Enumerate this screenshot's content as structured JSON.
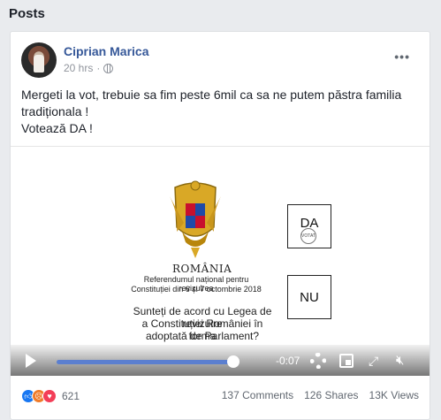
{
  "section": {
    "title": "Posts"
  },
  "post": {
    "author": "Ciprian Marica",
    "time": "20 hrs",
    "more": "•••",
    "text_lines": [
      "Mergeti la vot, trebuie sa fim peste 6mil ca sa ne putem păstra familia",
      "tradiționala !",
      "Votează DA !"
    ]
  },
  "ballot": {
    "country": "ROMÂNIA",
    "referendum_line1": "Referendumul național pentru revizuirea",
    "referendum_line2": "Constituției din 6 și 7 octombrie 2018",
    "question_lines": [
      "Sunteți de acord cu Legea de revizuire",
      "a Constituției României în forma",
      "adoptată de Parlament?"
    ],
    "answer_yes": "DA",
    "answer_no": "NU",
    "stamp_text": "VOTAT"
  },
  "video": {
    "time_remaining": "-0:07",
    "progress": 0.96
  },
  "engagement": {
    "reactions_count": "621",
    "comments": "137 Comments",
    "shares": "126 Shares",
    "views": "13K Views"
  }
}
